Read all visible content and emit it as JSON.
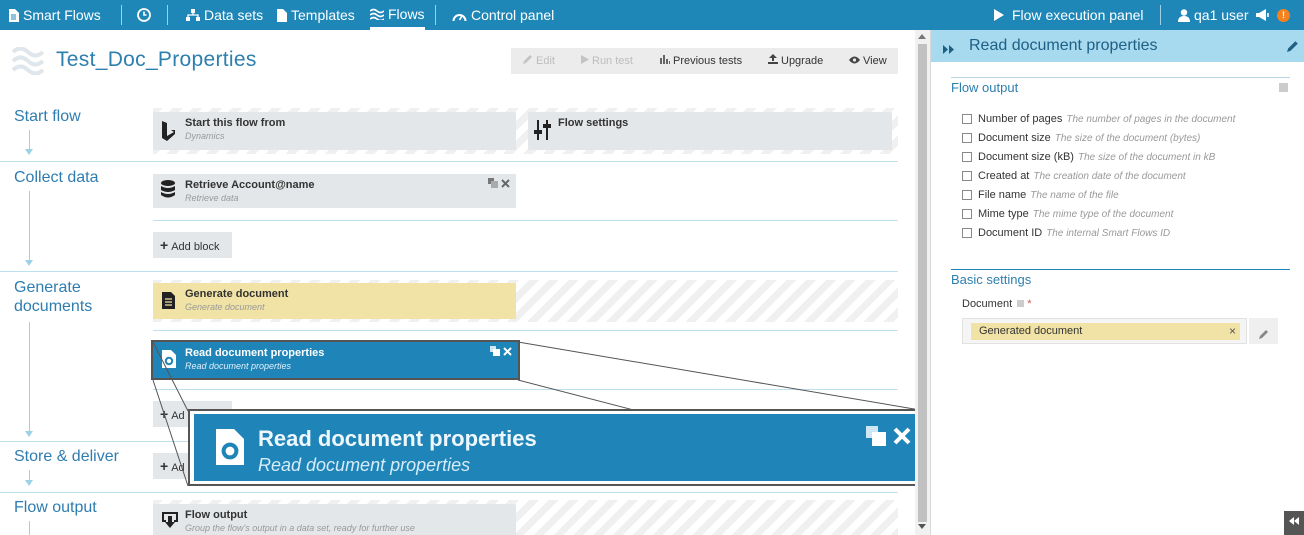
{
  "topbar": {
    "brand": "Smart Flows",
    "datasets": "Data sets",
    "templates": "Templates",
    "flows": "Flows",
    "control_panel": "Control panel",
    "flow_execution_panel": "Flow execution panel",
    "user": "qa1 user",
    "notification_badge": "!"
  },
  "page": {
    "title": "Test_Doc_Properties"
  },
  "toolbar": {
    "edit": "Edit",
    "run_test": "Run test",
    "previous_tests": "Previous tests",
    "upgrade": "Upgrade",
    "view": "View"
  },
  "sections": {
    "start_flow": "Start flow",
    "collect_data": "Collect data",
    "generate_documents_1": "Generate",
    "generate_documents_2": "documents",
    "store_deliver": "Store & deliver",
    "flow_output": "Flow output"
  },
  "blocks": {
    "start": {
      "title": "Start this flow from",
      "sub": "Dynamics"
    },
    "settings": {
      "title": "Flow settings"
    },
    "retrieve": {
      "title": "Retrieve Account@name",
      "sub": "Retrieve data"
    },
    "generate": {
      "title": "Generate document",
      "sub": "Generate document"
    },
    "read": {
      "title": "Read document properties",
      "sub": "Read document properties"
    },
    "output": {
      "title": "Flow output",
      "sub": "Group the flow's output in a data set, ready for further use"
    }
  },
  "add_block": "Add block",
  "add_block_partial": "Ad",
  "zoom": {
    "title": "Read document properties",
    "sub": "Read document properties"
  },
  "right_panel": {
    "title": "Read document properties",
    "flow_output_label": "Flow output",
    "outputs": [
      {
        "name": "Number of pages",
        "desc": "The number of pages in the document"
      },
      {
        "name": "Document size",
        "desc": "The size of the document (bytes)"
      },
      {
        "name": "Document size (kB)",
        "desc": "The size of the document in kB"
      },
      {
        "name": "Created at",
        "desc": "The creation date of the document"
      },
      {
        "name": "File name",
        "desc": "The name of the file"
      },
      {
        "name": "Mime type",
        "desc": "The mime type of the document"
      },
      {
        "name": "Document ID",
        "desc": "The internal Smart Flows ID"
      }
    ],
    "basic_settings_label": "Basic settings",
    "document_label": "Document",
    "required_mark": "*",
    "document_value": "Generated document",
    "tag_remove": "×"
  },
  "colors": {
    "topbar": "#1f87b8",
    "accent": "#2d7fae",
    "selected_block": "#1f84b8",
    "generate_block": "#f1e3a6",
    "badge": "#f5821f"
  }
}
